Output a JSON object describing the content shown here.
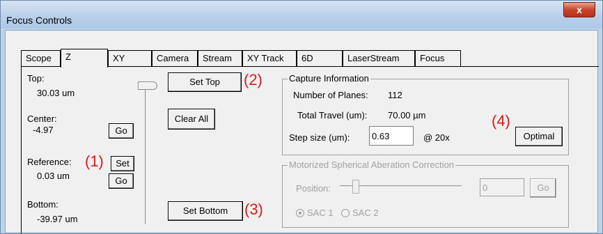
{
  "window": {
    "title": "Focus Controls",
    "close_glyph": "x"
  },
  "tabs": [
    {
      "label": "Scope"
    },
    {
      "label": "Z",
      "active": true
    },
    {
      "label": "XY"
    },
    {
      "label": "Camera"
    },
    {
      "label": "Stream"
    },
    {
      "label": "XY Track"
    },
    {
      "label": "6D"
    },
    {
      "label": "LaserStream"
    },
    {
      "label": "Focus"
    }
  ],
  "z_panel": {
    "top_label": "Top:",
    "top_value": "30.03 um",
    "center_label": "Center:",
    "center_value": "-4.97",
    "center_go": "Go",
    "reference_label": "Reference:",
    "reference_set": "Set",
    "reference_value": "0.03 um",
    "reference_go": "Go",
    "bottom_label": "Bottom:",
    "bottom_value": "-39.97 um",
    "set_top": "Set Top",
    "clear_all": "Clear All",
    "set_bottom": "Set Bottom"
  },
  "capture": {
    "title": "Capture Information",
    "planes_label": "Number of Planes:",
    "planes_value": "112",
    "travel_label": "Total Travel (um):",
    "travel_value": "70.00 µm",
    "step_label": "Step size (um):",
    "step_value": "0.63",
    "magnification": "@ 20x",
    "optimal": "Optimal"
  },
  "sac": {
    "title": "Motorized Spherical Aberation Correction",
    "position_label": "Position:",
    "position_value": "0",
    "go": "Go",
    "sac1": "SAC 1",
    "sac2": "SAC 2",
    "sac1_checked": true
  },
  "annotations": [
    "(1)",
    "(2)",
    "(3)",
    "(4)"
  ],
  "colors": {
    "annotation": "#d91a1a",
    "titlebar": "#b8cfe9",
    "close": "#c8452c"
  }
}
